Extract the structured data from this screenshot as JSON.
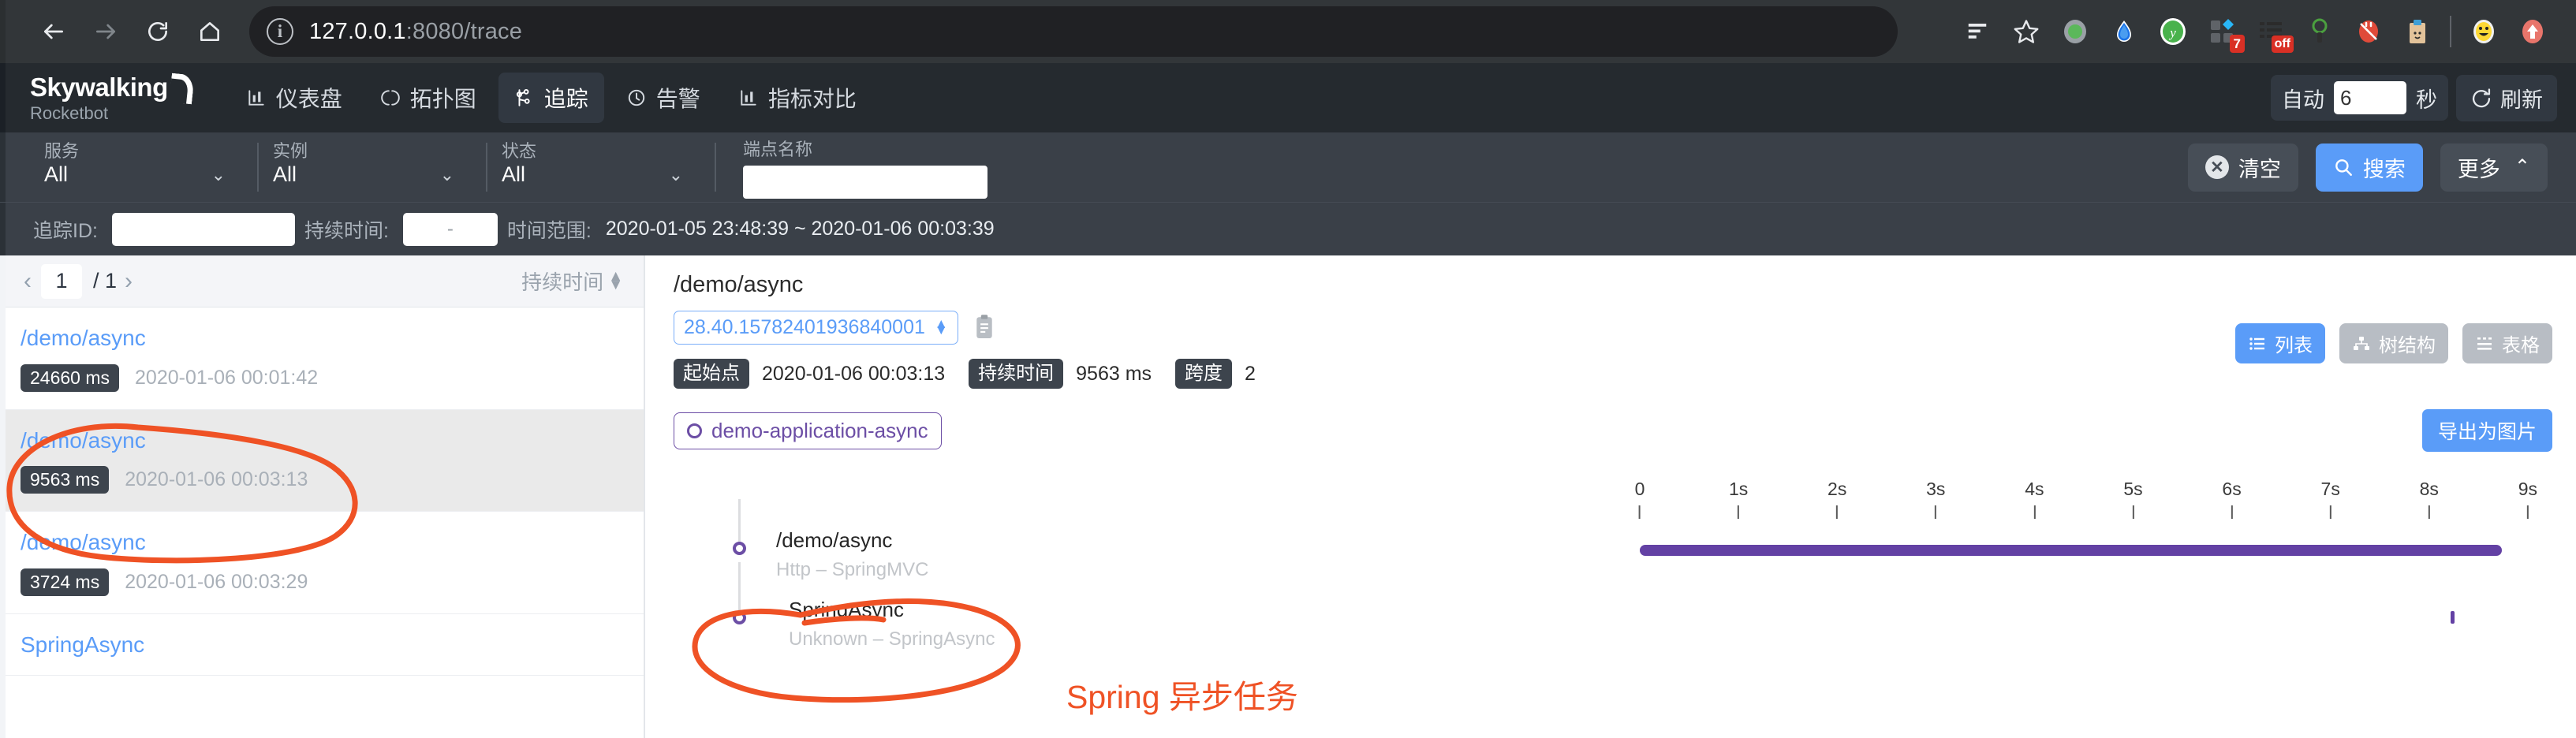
{
  "browser": {
    "back_icon": "back-arrow-icon",
    "forward_icon": "forward-arrow-icon",
    "reload_icon": "reload-icon",
    "home_icon": "home-icon",
    "site_info_icon": "info-circle-icon",
    "url_host": "127.0.0.1",
    "url_path": ":8080/trace",
    "url_full": "127.0.0.1:8080/trace",
    "extensions": [
      {
        "name": "reading-list-icon",
        "badge": ""
      },
      {
        "name": "bookmark-star-icon",
        "badge": ""
      },
      {
        "name": "green-circle-extension-icon",
        "badge": ""
      },
      {
        "name": "blue-drop-extension-icon",
        "badge": ""
      },
      {
        "name": "green-y-extension-icon",
        "badge": ""
      },
      {
        "name": "blocks-extension-icon",
        "badge": "7"
      },
      {
        "name": "list-extension-icon",
        "badge": "off"
      },
      {
        "name": "magnifier-extension-icon",
        "badge": ""
      },
      {
        "name": "red-plug-extension-icon",
        "badge": ""
      },
      {
        "name": "clipboard-extension-icon",
        "badge": ""
      },
      {
        "name": "emoji-extension-icon",
        "badge": ""
      },
      {
        "name": "profile-avatar-icon",
        "badge": ""
      }
    ]
  },
  "app": {
    "logo_main": "Skywalking",
    "logo_sub": "Rocketbot",
    "menu": [
      {
        "label": "仪表盘",
        "icon": "dashboard-icon",
        "active": false
      },
      {
        "label": "拓扑图",
        "icon": "topology-icon",
        "active": false
      },
      {
        "label": "追踪",
        "icon": "trace-icon",
        "active": true
      },
      {
        "label": "告警",
        "icon": "alarm-icon",
        "active": false
      },
      {
        "label": "指标对比",
        "icon": "compare-icon",
        "active": false
      }
    ],
    "auto": {
      "label": "自动",
      "value": "6",
      "unit": "秒",
      "refresh_label": "刷新",
      "refresh_icon": "refresh-icon"
    }
  },
  "filters": {
    "selects": [
      {
        "label": "服务",
        "value": "All",
        "caret": "chevron-down-icon"
      },
      {
        "label": "实例",
        "value": "All",
        "caret": "chevron-down-icon"
      },
      {
        "label": "状态",
        "value": "All",
        "caret": "chevron-down-icon"
      }
    ],
    "endpoint": {
      "label": "端点名称",
      "value": "",
      "placeholder": ""
    },
    "clear_label": "清空",
    "search_label": "搜索",
    "more_label": "更多",
    "more_caret": "chevron-up-icon",
    "trace_id_label": "追踪ID:",
    "trace_id_value": "",
    "duration_label": "持续时间:",
    "duration_value": "-",
    "time_range_label": "时间范围:",
    "time_range_value": "2020-01-05 23:48:39 ~ 2020-01-06 00:03:39"
  },
  "list": {
    "pager": {
      "prev_icon": "chevron-left-icon",
      "next_icon": "chevron-right-icon",
      "page": "1",
      "total": "/ 1",
      "sort_label": "持续时间"
    },
    "items": [
      {
        "name": "/demo/async",
        "duration": "24660 ms",
        "time": "2020-01-06 00:01:42",
        "selected": false
      },
      {
        "name": "/demo/async",
        "duration": "9563 ms",
        "time": "2020-01-06 00:03:13",
        "selected": true
      },
      {
        "name": "/demo/async",
        "duration": "3724 ms",
        "time": "2020-01-06 00:03:29",
        "selected": false
      },
      {
        "name": "SpringAsync",
        "duration": "",
        "time": "",
        "selected": false
      }
    ]
  },
  "detail": {
    "title": "/demo/async",
    "trace_id": "28.40.15782401936840001",
    "copy_icon": "clipboard-copy-icon",
    "start_label": "起始点",
    "start_value": "2020-01-06 00:03:13",
    "duration_label": "持续时间",
    "duration_value": "9563 ms",
    "span_label": "跨度",
    "span_value": "2",
    "view_modes": [
      {
        "label": "列表",
        "icon": "list-view-icon",
        "active": true
      },
      {
        "label": "树结构",
        "icon": "tree-view-icon",
        "active": false
      },
      {
        "label": "表格",
        "icon": "table-view-icon",
        "active": false
      }
    ],
    "service_tag": "demo-application-async",
    "export_label": "导出为图片"
  },
  "timeline": {
    "ticks": [
      "0",
      "1s",
      "2s",
      "3s",
      "4s",
      "5s",
      "6s",
      "7s",
      "8s",
      "9s"
    ],
    "spans": [
      {
        "name": "/demo/async",
        "sub": "Http – SpringMVC",
        "bar_start_pct": 0.0,
        "bar_width_pct": 97.0,
        "indent": 0
      },
      {
        "name": "SpringAsync",
        "sub": "Unknown – SpringAsync",
        "bar_start_pct": 91.2,
        "bar_width_pct": 0.45,
        "indent": 1
      }
    ]
  },
  "annotations": {
    "color": "#ef5225",
    "text": "Spring 异步任务",
    "ellipse_list_item": "highlight-selected-trace",
    "ellipse_span": "highlight-springasync-span"
  }
}
